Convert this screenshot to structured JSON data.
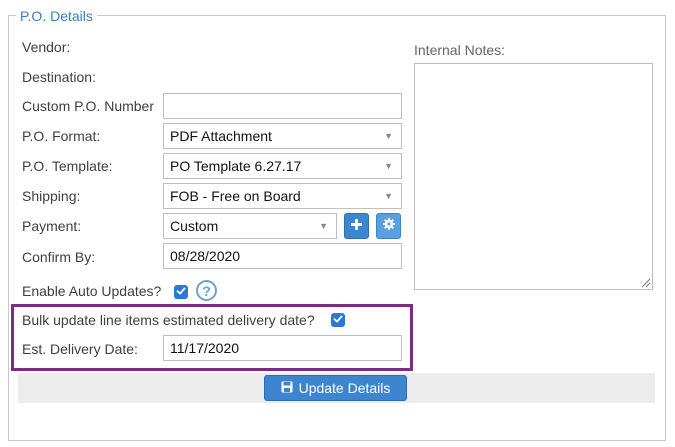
{
  "section": {
    "legend": "P.O. Details"
  },
  "labels": {
    "vendor": "Vendor:",
    "destination": "Destination:",
    "custom_po": "Custom P.O. Number",
    "po_format": "P.O. Format:",
    "po_template": "P.O. Template:",
    "shipping": "Shipping:",
    "payment": "Payment:",
    "confirm_by": "Confirm By:",
    "auto_updates": "Enable Auto Updates?",
    "bulk_update": "Bulk update line items estimated delivery date?",
    "est_delivery": "Est. Delivery Date:",
    "internal_notes": "Internal Notes:"
  },
  "values": {
    "custom_po": "",
    "po_format": "PDF Attachment",
    "po_template": "PO Template 6.27.17",
    "shipping": "FOB - Free on Board",
    "payment": "Custom",
    "confirm_by": "08/28/2020",
    "est_delivery": "11/17/2020",
    "internal_notes": ""
  },
  "checkboxes": {
    "auto_updates": true,
    "bulk_update": true
  },
  "help": {
    "glyph": "?"
  },
  "buttons": {
    "update": "Update Details"
  },
  "icons": {
    "add": "plus-icon",
    "settings": "gear-icon",
    "help": "question-icon",
    "save": "floppy-disk-icon",
    "check": "checkmark-icon",
    "dropdown": "caret-down-icon"
  },
  "colors": {
    "accent": "#3d86cf",
    "legend": "#3a7fc4",
    "highlight_border": "#7b2d86",
    "checkbox": "#2a79d6"
  }
}
